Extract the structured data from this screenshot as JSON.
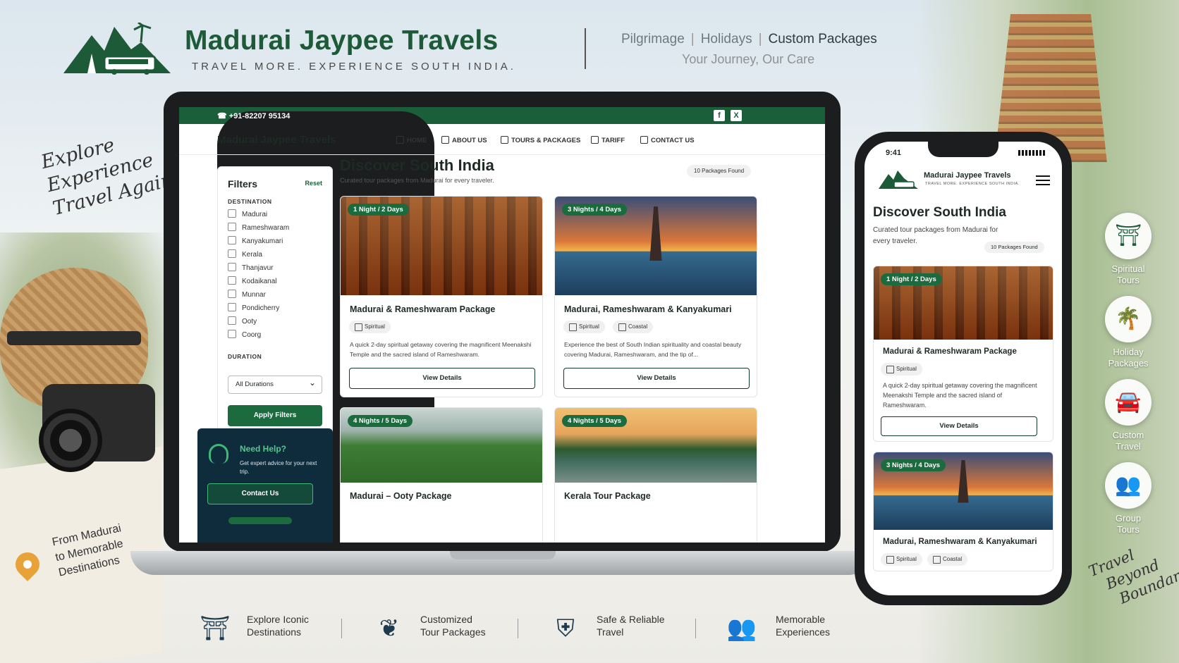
{
  "brand": {
    "title": "Madurai Jaypee Travels",
    "tagline": "TRAVEL MORE. EXPERIENCE SOUTH INDIA."
  },
  "header_nav": {
    "items": [
      "Pilgrimage",
      "Holidays",
      "Custom Packages"
    ],
    "separator": "|",
    "subtitle": "Your Journey, Our Care"
  },
  "script_texts": {
    "left_top": [
      "Explore",
      "Experience",
      "Travel Again"
    ],
    "left_bottom": [
      "From Madurai",
      "to Memorable",
      "Destinations"
    ],
    "right_bottom": [
      "Travel",
      "Beyond",
      "Boundaries"
    ]
  },
  "laptop": {
    "topbar": {
      "phone": "+91-82207 95134",
      "social": [
        "f",
        "X"
      ]
    },
    "site_name": "Madurai Jaypee Travels",
    "nav": [
      {
        "label": "HOME",
        "icon": "home-icon"
      },
      {
        "label": "ABOUT US",
        "icon": "user-icon"
      },
      {
        "label": "TOURS & PACKAGES",
        "icon": "bell-icon"
      },
      {
        "label": "TARIFF",
        "icon": "car-icon"
      },
      {
        "label": "CONTACT US",
        "icon": "mail-icon"
      }
    ],
    "filters": {
      "title": "Filters",
      "reset": "Reset",
      "destination_label": "DESTINATION",
      "destinations": [
        "Madurai",
        "Rameshwaram",
        "Kanyakumari",
        "Kerala",
        "Thanjavur",
        "Kodaikanal",
        "Munnar",
        "Pondicherry",
        "Ooty",
        "Coorg"
      ],
      "duration_label": "DURATION",
      "duration_value": "All Durations",
      "apply": "Apply Filters"
    },
    "help": {
      "title": "Need Help?",
      "text": "Get expert advice for your next trip.",
      "button": "Contact Us"
    },
    "main": {
      "title": "Discover South India",
      "subtitle": "Curated tour packages from Madurai for every traveler.",
      "found": "10 Packages Found"
    },
    "cards": [
      {
        "badge": "1 Night / 2 Days",
        "title": "Madurai & Rameshwaram Package",
        "tags": [
          "Spiritual"
        ],
        "desc": "A quick 2-day spiritual getaway covering the magnificent Meenakshi Temple and the sacred island of Rameshwaram.",
        "button": "View Details"
      },
      {
        "badge": "3 Nights / 4 Days",
        "title": "Madurai, Rameshwaram & Kanyakumari",
        "tags": [
          "Spiritual",
          "Coastal"
        ],
        "desc": "Experience the best of South Indian spirituality and coastal beauty covering Madurai, Rameshwaram, and the tip of...",
        "button": "View Details"
      },
      {
        "badge": "4 Nights / 5 Days",
        "title": "Madurai – Ooty Package"
      },
      {
        "badge": "4 Nights / 5 Days",
        "title": "Kerala Tour Package"
      }
    ]
  },
  "phone": {
    "time": "9:41",
    "brand": "Madurai Jaypee Travels",
    "tagline": "TRAVEL MORE. EXPERIENCE SOUTH INDIA.",
    "title": "Discover South India",
    "subtitle": "Curated tour packages from Madurai for every traveler.",
    "found": "10 Packages Found",
    "cards": [
      {
        "badge": "1 Night / 2 Days",
        "title": "Madurai & Rameshwaram Package",
        "tags": [
          "Spiritual"
        ],
        "desc": "A quick 2-day spiritual getaway covering the magnificent Meenakshi Temple and the sacred island of Rameshwaram.",
        "button": "View Details"
      },
      {
        "badge": "3 Nights / 4 Days",
        "title": "Madurai, Rameshwaram & Kanyakumari",
        "tags": [
          "Spiritual",
          "Coastal"
        ]
      }
    ]
  },
  "side_features": [
    {
      "label": [
        "Spiritual",
        "Tours"
      ],
      "icon": "temple-icon"
    },
    {
      "label": [
        "Holiday",
        "Packages"
      ],
      "icon": "palm-island-icon"
    },
    {
      "label": [
        "Custom",
        "Travel"
      ],
      "icon": "car-icon"
    },
    {
      "label": [
        "Group",
        "Tours"
      ],
      "icon": "group-icon"
    }
  ],
  "bottom_features": [
    {
      "label": [
        "Explore Iconic",
        "Destinations"
      ],
      "icon": "temple-icon"
    },
    {
      "label": [
        "Customized",
        "Tour Packages"
      ],
      "icon": "leaf-icon"
    },
    {
      "label": [
        "Safe & Reliable",
        "Travel"
      ],
      "icon": "shield-check-icon"
    },
    {
      "label": [
        "Memorable",
        "Experiences"
      ],
      "icon": "group-icon"
    }
  ],
  "colors": {
    "brand_green": "#1d5a37",
    "topbar_green": "#1b5e3a",
    "help_bg": "#0f2c3c"
  }
}
